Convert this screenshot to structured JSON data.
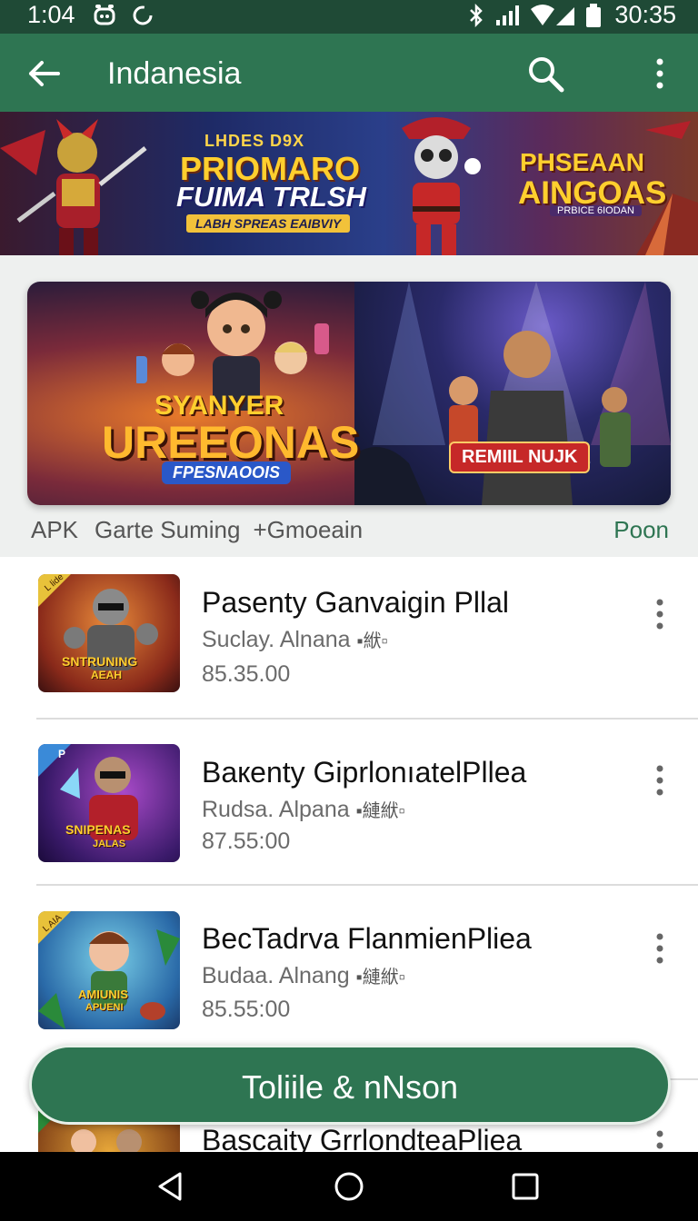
{
  "status": {
    "time": "1:04",
    "clock": "30:35",
    "icons": [
      "alarm-icon",
      "sync-icon",
      "bluetooth-icon",
      "signal-icon",
      "wifi-icon",
      "battery-icon"
    ]
  },
  "appbar": {
    "title": "Indanesia",
    "icons": [
      "back-arrow-icon",
      "search-icon",
      "more-vert-icon"
    ]
  },
  "top_banner": {
    "left_small": "LHDES D9X",
    "left_title_1": "PRIOMARO",
    "left_title_2": "FUIMA TRLSH",
    "left_tag": "LABH SPREAS EAIBVIY",
    "right_title_1": "PHSEAAN",
    "right_title_2": "AINGOAS",
    "right_tag": "PRBICE 6IODAN"
  },
  "featured": {
    "title_1": "SYANYER",
    "title_2": "UREEONAS",
    "title_3": "FPESNAOOIS",
    "cta": "REMIIL NUJK",
    "meta_a": "APK",
    "meta_b": "Garte Suming",
    "meta_c": "+Gmoeain",
    "link": "Poon"
  },
  "list": [
    {
      "name": "Pasenty Ganvaigin Pllal",
      "sub": "Suclay. Alnana",
      "sub_badge": "▪絥▫",
      "price": "85.35.00",
      "thumb_text_1": "SNTRUNING",
      "thumb_text_2": "AEAH",
      "thumb_badge": "L lide"
    },
    {
      "name": "Baкenty GiprlonıatelPllea",
      "sub": "Rudsa. Alpana",
      "sub_badge": "▪縺絥▫",
      "price": "87.55:00",
      "thumb_text_1": "SNIPENAS",
      "thumb_text_2": "JALAS",
      "thumb_badge": "P"
    },
    {
      "name": "BecTadrva FlanmienPliea",
      "sub": "Budaa. Alnang",
      "sub_badge": "▪縺絥▫",
      "price": "85.55:00",
      "thumb_text_1": "AMIUNIS",
      "thumb_text_2": "APUENI",
      "thumb_badge": "L AIA"
    },
    {
      "name": "Bascaity GrrlondteaPliea"
    }
  ],
  "bottom_button": "Toliile & nNson",
  "navbar": {
    "icons": [
      "back-triangle-icon",
      "home-circle-icon",
      "recents-square-icon"
    ]
  },
  "colors": {
    "primary": "#2e7552",
    "status_bar": "#1f4a36",
    "accent_link": "#2e7552"
  }
}
